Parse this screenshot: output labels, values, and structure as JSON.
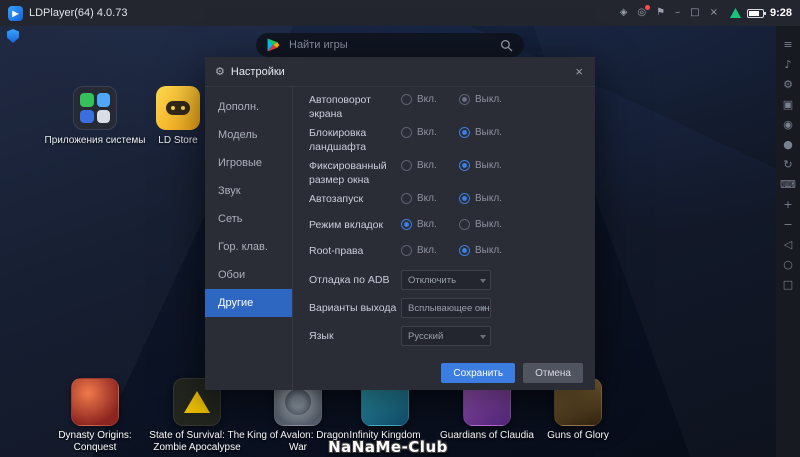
{
  "titlebar": {
    "title": "LDPlayer(64) 4.0.73",
    "time": "9:28",
    "window_icons": [
      {
        "name": "gift-icon",
        "glyph": "◈"
      },
      {
        "name": "notification-bell-icon",
        "glyph": "◎"
      },
      {
        "name": "pin-icon",
        "glyph": "⚑"
      },
      {
        "name": "minimize-icon",
        "glyph": "–"
      },
      {
        "name": "maximize-icon",
        "glyph": "□"
      },
      {
        "name": "close-icon",
        "glyph": "×"
      }
    ]
  },
  "search": {
    "placeholder": "Найти игры"
  },
  "desktop": {
    "apps": [
      {
        "label": "Приложения системы"
      },
      {
        "label": "LD Store"
      }
    ],
    "games": [
      {
        "label": "Dynasty Origins: Conquest"
      },
      {
        "label": "State of Survival: The Zombie Apocalypse"
      },
      {
        "label": "King of Avalon: Dragon War"
      },
      {
        "label": "Infinity Kingdom"
      },
      {
        "label": "Guardians of Claudia"
      },
      {
        "label": "Guns of Glory"
      }
    ],
    "watermark": "NaNaMe-Club"
  },
  "emulator_sidebar": {
    "icons": [
      {
        "name": "menu-icon",
        "glyph": "≡"
      },
      {
        "name": "sound-icon",
        "glyph": "♪"
      },
      {
        "name": "settings-icon",
        "glyph": "⚙"
      },
      {
        "name": "fullscreen-icon",
        "glyph": "▣"
      },
      {
        "name": "screenshot-icon",
        "glyph": "◉"
      },
      {
        "name": "record-icon",
        "glyph": "●"
      },
      {
        "name": "shake-icon",
        "glyph": "↻"
      },
      {
        "name": "keyboard-icon",
        "glyph": "⌨"
      },
      {
        "name": "volume-up-icon",
        "glyph": "+"
      },
      {
        "name": "volume-down-icon",
        "glyph": "−"
      },
      {
        "name": "back-icon",
        "glyph": "◁"
      },
      {
        "name": "home-icon",
        "glyph": "○"
      },
      {
        "name": "recents-icon",
        "glyph": "□"
      }
    ]
  },
  "dialog": {
    "icon_glyph": "⚙",
    "close_glyph": "×",
    "title": "Настройки",
    "tabs": [
      {
        "label": "Дополн."
      },
      {
        "label": "Модель"
      },
      {
        "label": "Игровые"
      },
      {
        "label": "Звук"
      },
      {
        "label": "Сеть"
      },
      {
        "label": "Гор. клав."
      },
      {
        "label": "Обои"
      },
      {
        "label": "Другие",
        "active": true
      }
    ],
    "radio_rows": [
      {
        "label": "Автоповорот экрана",
        "on_label": "Вкл.",
        "off_label": "Выкл.",
        "selected": "off",
        "disabled": true
      },
      {
        "label": "Блокировка ландшафта",
        "on_label": "Вкл.",
        "off_label": "Выкл.",
        "selected": "off"
      },
      {
        "label": "Фиксированный размер окна",
        "on_label": "Вкл.",
        "off_label": "Выкл.",
        "selected": "off"
      },
      {
        "label": "Автозапуск",
        "on_label": "Вкл.",
        "off_label": "Выкл.",
        "selected": "off"
      },
      {
        "label": "Режим вкладок",
        "on_label": "Вкл.",
        "off_label": "Выкл.",
        "selected": "on"
      },
      {
        "label": "Root-права",
        "on_label": "Вкл.",
        "off_label": "Выкл.",
        "selected": "off"
      }
    ],
    "select_rows": [
      {
        "label": "Отладка по ADB",
        "value": "Отключить"
      },
      {
        "label": "Варианты выхода",
        "value": "Всплывающее окно"
      },
      {
        "label": "Язык",
        "value": "Русский"
      }
    ],
    "save_label": "Сохранить",
    "cancel_label": "Отмена"
  },
  "colors": {
    "accent": "#3b7de0",
    "selected_tab": "#2e67c2",
    "dialog_bg": "#2a2d36",
    "titlebar_bg": "#23262e",
    "signal_green": "#18c57d"
  }
}
